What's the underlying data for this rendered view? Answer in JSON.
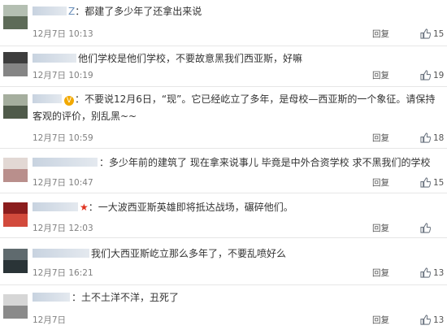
{
  "actions": {
    "reply_label": "回复",
    "like_icon": "thumbs-up-icon"
  },
  "colors": {
    "username": "#6a8fba",
    "meta": "#808080",
    "star": "#e0321f",
    "vip": "#f2a900"
  },
  "comments": [
    {
      "user_tail": "Z",
      "text": "：都建了多少年了还拿出来说",
      "time": "12月7日 10:13",
      "likes": "15"
    },
    {
      "user_tail": "",
      "text": "他们学校是他们学校，不要故意黑我们西亚斯，好嘛",
      "time": "12月7日 10:19",
      "likes": "19"
    },
    {
      "user_tail": "",
      "text": "：不要说12月6日，“现”。它已经屹立了多年，是母校—西亚斯的一个象征。请保持客观的评价，别乱黑~~",
      "time": "12月7日 10:59",
      "likes": "18"
    },
    {
      "user_tail": "",
      "text": "：多少年前的建筑了 现在拿来说事儿 毕竟是中外合资学校 求不黑我们的学校",
      "time": "12月7日 10:47",
      "likes": "15"
    },
    {
      "user_tail": "",
      "text": "：一大波西亚斯英雄即将抵达战场，碾碎他们。",
      "time": "12月7日 12:03",
      "likes": ""
    },
    {
      "user_tail": "",
      "text": "我们大西亚斯屹立那么多年了，不要乱喷好么",
      "time": "12月7日 16:21",
      "likes": "13"
    },
    {
      "user_tail": "",
      "text": "：土不土洋不洋，丑死了",
      "time": "12月7日",
      "likes": "13"
    }
  ]
}
